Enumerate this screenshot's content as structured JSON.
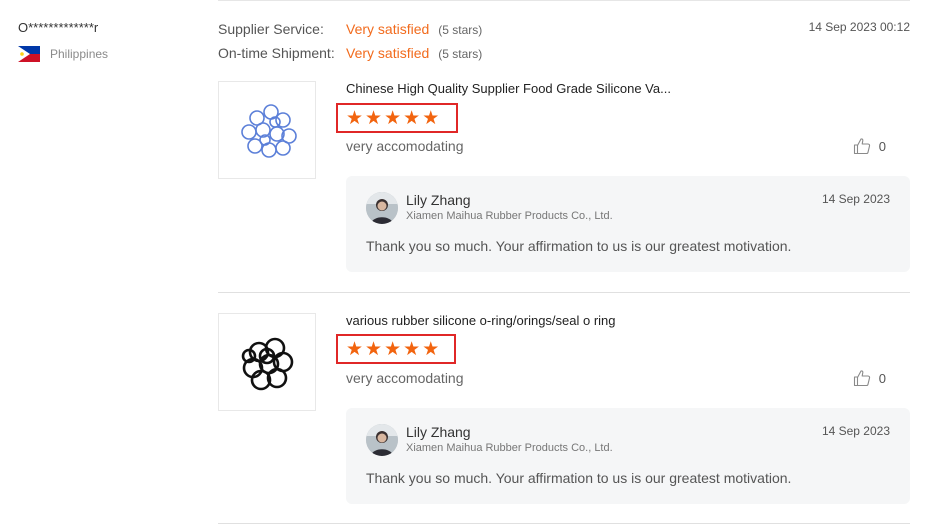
{
  "buyer": {
    "name": "O*************r",
    "country": "Philippines"
  },
  "ratings": [
    {
      "label": "Supplier Service:",
      "value": "Very satisfied",
      "stars_text": "(5 stars)"
    },
    {
      "label": "On-time Shipment:",
      "value": "Very satisfied",
      "stars_text": "(5 stars)"
    }
  ],
  "review_date": "14 Sep 2023 00:12",
  "reviews": [
    {
      "product_title": "Chinese High Quality Supplier Food Grade Silicone Va...",
      "rating": 5,
      "comment": "very accomodating",
      "likes": "0",
      "thumb_icon": "blue-silicone-rings",
      "reply": {
        "name": "Lily Zhang",
        "company": "Xiamen Maihua Rubber Products Co., Ltd.",
        "date": "14 Sep 2023",
        "text": "Thank you so much. Your affirmation to us is our greatest motivation."
      }
    },
    {
      "product_title": "various rubber silicone o-ring/orings/seal o ring",
      "rating": 5,
      "comment": "very accomodating",
      "likes": "0",
      "thumb_icon": "black-o-rings",
      "reply": {
        "name": "Lily Zhang",
        "company": "Xiamen Maihua Rubber Products Co., Ltd.",
        "date": "14 Sep 2023",
        "text": "Thank you so much. Your affirmation to us is our greatest motivation."
      }
    }
  ],
  "colors": {
    "accent": "#f26b1d",
    "star": "#f2640f",
    "highlight_border": "#e02727"
  }
}
